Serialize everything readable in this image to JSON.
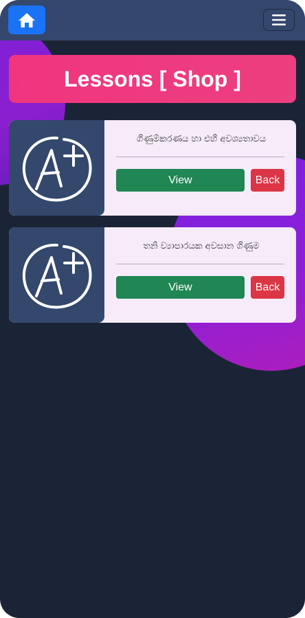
{
  "header": {
    "home_icon": "home-icon",
    "menu_icon": "hamburger-menu-icon"
  },
  "page": {
    "title": "Lessons [ Shop ]"
  },
  "lessons": [
    {
      "title": "ගිණුම්කරණය හා එහි අවශ්‍යතාවය",
      "thumbnail_icon": "a-plus-grade-icon",
      "view_label": "View",
      "back_label": "Back"
    },
    {
      "title": "තනි ව්‍යාපාරයක අවසාන ගිණුම",
      "thumbnail_icon": "a-plus-grade-icon",
      "view_label": "View",
      "back_label": "Back"
    }
  ],
  "colors": {
    "background": "#1b2436",
    "header": "#34476d",
    "home_button": "#1a73f5",
    "title_banner": "#f0357e",
    "card": "#f7ebfa",
    "view_button": "#1f8654",
    "back_button": "#dc3545",
    "blob": "#8a1fd0"
  }
}
